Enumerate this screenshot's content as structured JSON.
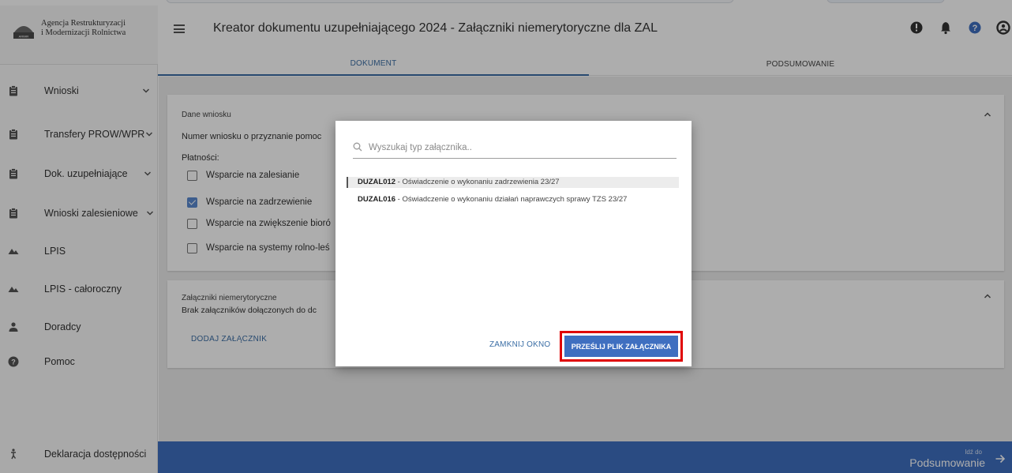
{
  "app": {
    "org_line1": "Agencja Restrukturyzacji",
    "org_line2": "i Modernizacji Rolnictwa",
    "logo_abbrev": "ARiMR"
  },
  "header": {
    "title": "Kreator dokumentu uzupełniającego 2024 - Załączniki niemerytoryczne dla ZAL",
    "icons": [
      "info-icon",
      "bell-icon",
      "help-icon",
      "account-icon"
    ]
  },
  "tabs": [
    {
      "label": "DOKUMENT",
      "active": true
    },
    {
      "label": "PODSUMOWANIE",
      "active": false
    }
  ],
  "sidebar": {
    "items": [
      {
        "label": "Wnioski",
        "icon": "clipboard-icon",
        "expandable": true
      },
      {
        "label": "Transfery PROW/WPR",
        "icon": "clipboard-icon",
        "expandable": true
      },
      {
        "label": "Dok. uzupełniające",
        "icon": "clipboard-icon",
        "expandable": true
      },
      {
        "label": "Wnioski zalesieniowe",
        "icon": "clipboard-icon",
        "expandable": true
      },
      {
        "label": "LPIS",
        "icon": "terrain-icon",
        "expandable": false
      },
      {
        "label": "LPIS - całoroczny",
        "icon": "terrain-icon",
        "expandable": false
      },
      {
        "label": "Doradcy",
        "icon": "person-icon",
        "expandable": false
      },
      {
        "label": "Pomoc",
        "icon": "help-icon",
        "expandable": false
      }
    ],
    "footer": {
      "label": "Deklaracja dostępności",
      "icon": "accessibility-icon"
    }
  },
  "main": {
    "card1": {
      "title": "Dane wniosku",
      "number_label": "Numer wniosku o przyznanie pomoc",
      "payments_label": "Płatności:",
      "checkboxes": [
        {
          "label": "Wsparcie na zalesianie",
          "checked": false
        },
        {
          "label": "Wsparcie na zadrzewienie",
          "checked": true
        },
        {
          "label": "Wsparcie na zwiększenie bioró",
          "checked": false
        },
        {
          "label": "Wsparcie na systemy rolno-leś",
          "checked": false
        }
      ]
    },
    "card2": {
      "title": "Załączniki niemerytoryczne",
      "empty_text": "Brak załączników dołączonych do dc",
      "add_label": "DODAJ ZAŁĄCZNIK"
    }
  },
  "dialog": {
    "search_placeholder": "Wyszukaj typ załącznika..",
    "options": [
      {
        "code": "DUZAL012",
        "text": " - Oświadczenie o wykonaniu zadrzewienia 23/27",
        "highlighted": true
      },
      {
        "code": "DUZAL016",
        "text": " - Oświadczenie o wykonaniu działań naprawczych sprawy TZS 23/27",
        "highlighted": false
      }
    ],
    "close_label": "ZAMKNIJ OKNO",
    "upload_label": "PRZEŚLIJ PLIK ZAŁĄCZNIKA"
  },
  "footer_bar": {
    "small_label": "Idź do",
    "big_label": "Podsumowanie"
  },
  "colors": {
    "primary": "#3f6fc0",
    "link": "#3b6ea5",
    "checkbox_checked": "#5a8ad0",
    "highlight_frame": "#e00000",
    "content_bg": "#ececec"
  }
}
